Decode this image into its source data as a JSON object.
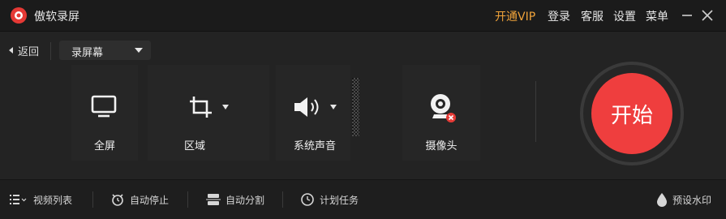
{
  "window": {
    "title": "傲软录屏",
    "menu": {
      "vip": "开通VIP",
      "login": "登录",
      "service": "客服",
      "settings": "设置",
      "menu": "菜单"
    }
  },
  "toolbar": {
    "back_label": "返回",
    "mode_selected": "录屏幕"
  },
  "tiles": {
    "fullscreen": "全屏",
    "region": "区域",
    "system_sound": "系统声音",
    "camera": "摄像头"
  },
  "start_label": "开始",
  "bottom": {
    "video_list": "视频列表",
    "auto_stop": "自动停止",
    "auto_split": "自动分割",
    "schedule": "计划任务",
    "watermark": "预设水印"
  },
  "colors": {
    "accent_red": "#ef3e3e",
    "vip_orange": "#f0a33a"
  }
}
